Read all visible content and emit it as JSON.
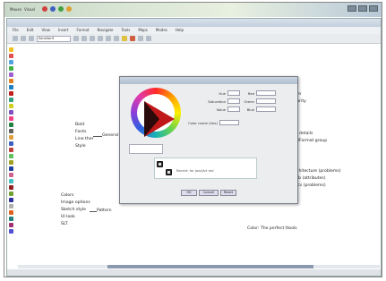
{
  "desktop": {
    "taskbar_text": "Mouse",
    "taskbar_text2": "Visual"
  },
  "app": {
    "title": ""
  },
  "menu": [
    "File",
    "Edit",
    "View",
    "Insert",
    "Format",
    "Navigate",
    "Tools",
    "Maps",
    "Modes",
    "Help"
  ],
  "toolbar": {
    "font_field": "SansSerif"
  },
  "palette_colors": [
    "#f0c020",
    "#e05050",
    "#50a0e0",
    "#40b040",
    "#a060d0",
    "#e08020",
    "#2080c0",
    "#c02020",
    "#30a080",
    "#d0d020",
    "#8050c0",
    "#f04080",
    "#208040",
    "#606060",
    "#e0a040",
    "#4060c0",
    "#c04040",
    "#60c060",
    "#a0a020",
    "#2040a0",
    "#d06090",
    "#40c0c0",
    "#902020",
    "#70a030",
    "#3030a0",
    "#b0b0b0",
    "#e06020",
    "#208080",
    "#a03070",
    "#5050d0"
  ],
  "mindmap": {
    "left": [
      "Bold",
      "Fonts",
      "Line ther",
      "Style"
    ],
    "left_group": "General",
    "left2": [
      "Colors",
      "Image options",
      "Sketch style",
      "UI look",
      "SLT"
    ],
    "left2_group": "Pattern",
    "right": [
      "Zoom",
      "Security",
      "LG"
    ],
    "right2": [
      "Line details",
      "Line/Format group"
    ],
    "right3": [
      "Architecture (problems)",
      "Web (attributes)",
      "Docs (problems)"
    ],
    "center_label": "Color: The perfect ttools"
  },
  "dialog": {
    "field1_label": "Hue",
    "field2_label": "Saturation",
    "field3_label": "Value",
    "field4_label": "Red",
    "field5_label": "Green",
    "field6_label": "Blue",
    "hex_label": "Color name (hex)",
    "recent_label": "Recent: for Jazz/Art red",
    "buttons": [
      "OK",
      "Cancel",
      "Reset"
    ]
  },
  "status": {
    "text": ""
  }
}
